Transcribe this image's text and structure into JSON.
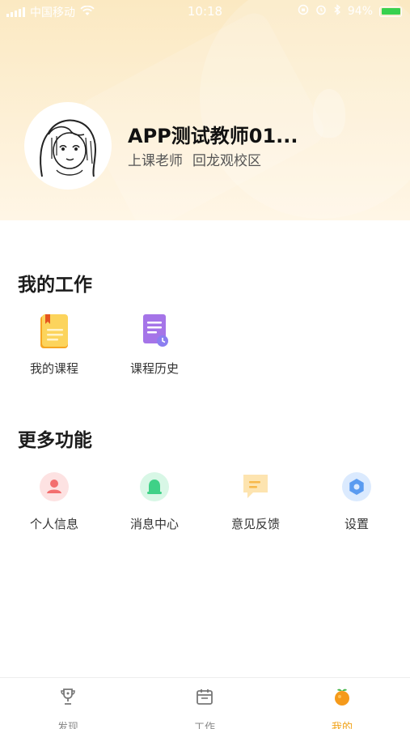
{
  "status_bar": {
    "carrier": "中国移动",
    "time": "10:18",
    "battery_text": "94%"
  },
  "profile": {
    "name": "APP测试教师01...",
    "role": "上课老师",
    "campus": "回龙观校区"
  },
  "work_section": {
    "title": "我的工作",
    "items": [
      {
        "label": "我的课程",
        "icon": "course-book-icon"
      },
      {
        "label": "课程历史",
        "icon": "course-history-icon"
      }
    ]
  },
  "more_section": {
    "title": "更多功能",
    "items": [
      {
        "label": "个人信息",
        "icon": "person-icon"
      },
      {
        "label": "消息中心",
        "icon": "bell-icon"
      },
      {
        "label": "意见反馈",
        "icon": "feedback-chat-icon"
      },
      {
        "label": "设置",
        "icon": "settings-gear-icon"
      }
    ]
  },
  "tab_bar": {
    "active": "我的",
    "tabs": [
      {
        "label": "发现",
        "icon": "trophy-icon"
      },
      {
        "label": "工作",
        "icon": "calendar-icon"
      },
      {
        "label": "我的",
        "icon": "orange-fruit-icon"
      }
    ]
  },
  "colors": {
    "accent": "#f0a218",
    "header_bg": "#fbe9c2",
    "battery": "#38d14f"
  }
}
